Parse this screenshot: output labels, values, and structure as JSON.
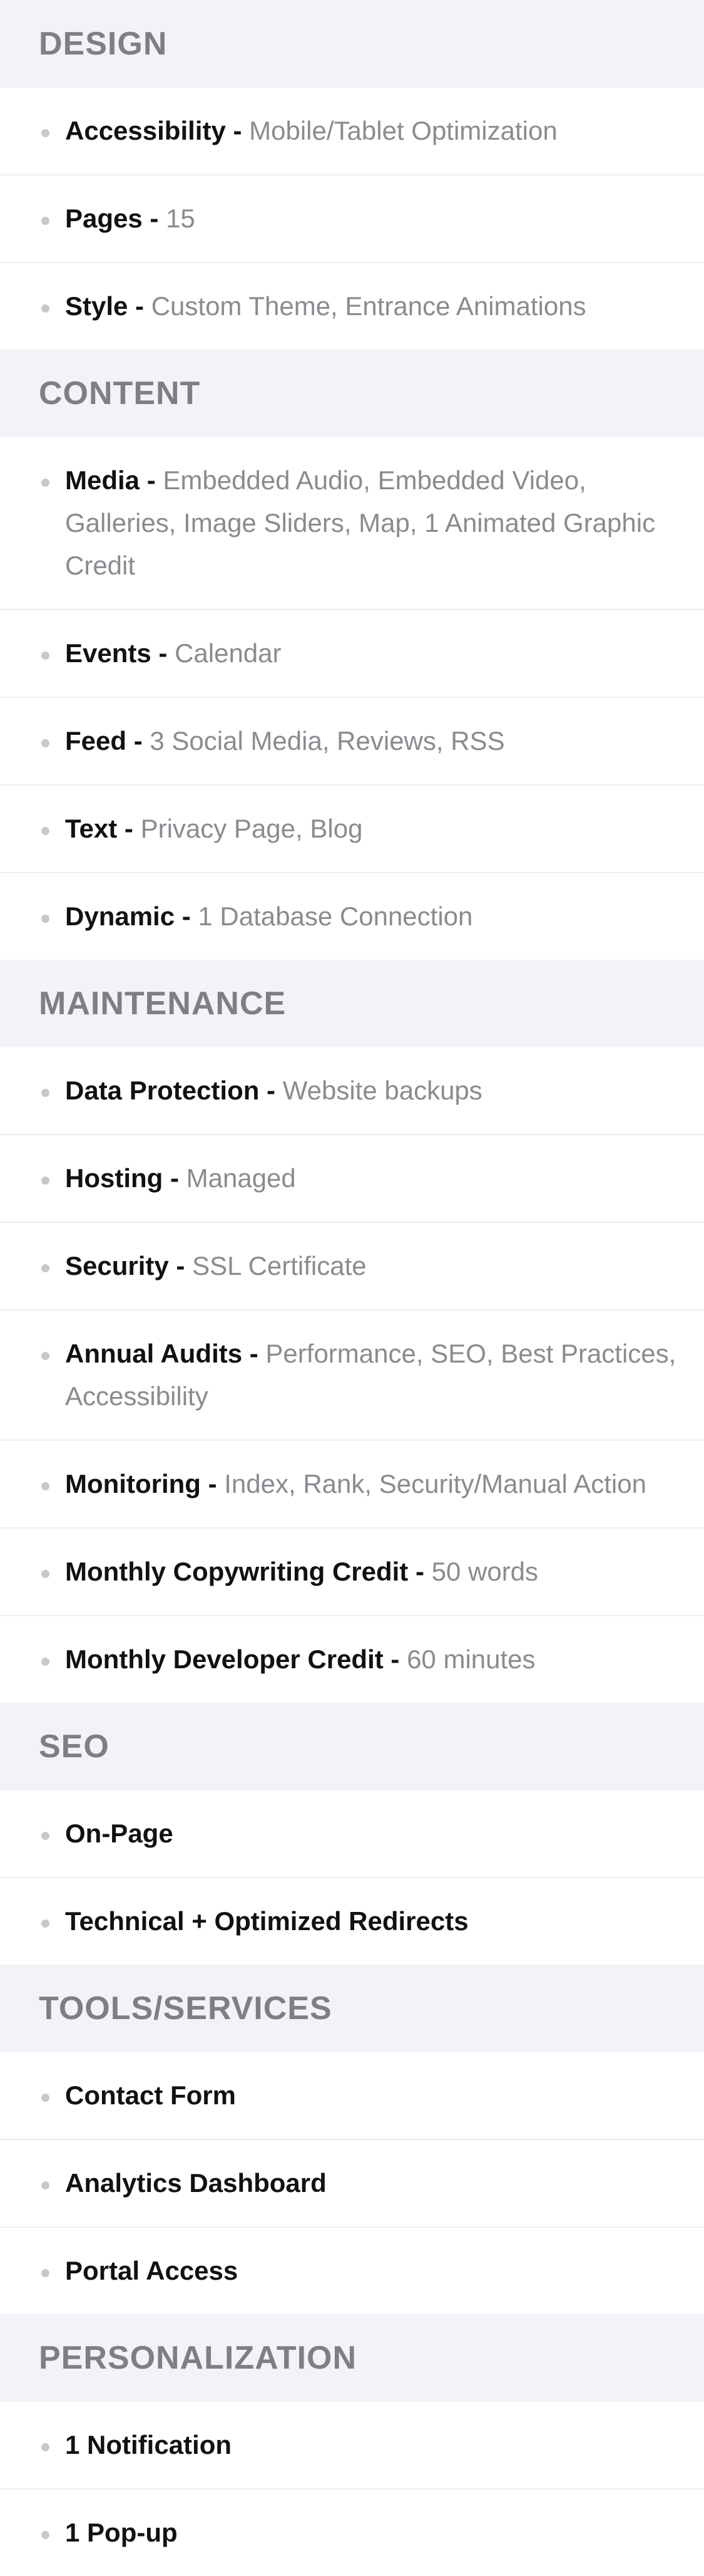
{
  "sections": [
    {
      "title": "DESIGN",
      "items": [
        {
          "label": "Accessibility",
          "sep": " - ",
          "value": "Mobile/Tablet Optimization"
        },
        {
          "label": "Pages",
          "sep": " - ",
          "value": "15"
        },
        {
          "label": "Style",
          "sep": " - ",
          "value": "Custom Theme, Entrance Animations"
        }
      ]
    },
    {
      "title": "CONTENT",
      "items": [
        {
          "label": "Media",
          "sep": " - ",
          "value": "Embedded Audio, Embedded Video, Galleries, Image Sliders, Map, 1 Animated Graphic Credit"
        },
        {
          "label": "Events",
          "sep": " - ",
          "value": "Calendar"
        },
        {
          "label": "Feed",
          "sep": " - ",
          "value": "3 Social Media, Reviews, RSS"
        },
        {
          "label": "Text",
          "sep": " - ",
          "value": "Privacy Page, Blog"
        },
        {
          "label": "Dynamic",
          "sep": " - ",
          "value": "1 Database Connection"
        }
      ]
    },
    {
      "title": "MAINTENANCE",
      "items": [
        {
          "label": "Data Protection",
          "sep": " - ",
          "value": "Website backups"
        },
        {
          "label": "Hosting",
          "sep": " - ",
          "value": "Managed"
        },
        {
          "label": "Security",
          "sep": " - ",
          "value": "SSL Certificate"
        },
        {
          "label": "Annual Audits",
          "sep": " - ",
          "value": "Performance, SEO, Best Practices, Accessibility"
        },
        {
          "label": "Monitoring",
          "sep": " - ",
          "value": "Index, Rank, Security/Manual Action"
        },
        {
          "label": "Monthly Copywriting Credit",
          "sep": " - ",
          "value": "50 words"
        },
        {
          "label": "Monthly Developer Credit",
          "sep": " - ",
          "value": "60 minutes"
        }
      ]
    },
    {
      "title": "SEO",
      "items": [
        {
          "label": "On-Page",
          "sep": "",
          "value": ""
        },
        {
          "label": "Technical + Optimized Redirects",
          "sep": "",
          "value": ""
        }
      ]
    },
    {
      "title": "TOOLS/SERVICES",
      "items": [
        {
          "label": "Contact Form",
          "sep": "",
          "value": ""
        },
        {
          "label": "Analytics Dashboard",
          "sep": "",
          "value": ""
        },
        {
          "label": "Portal Access",
          "sep": "",
          "value": ""
        }
      ]
    },
    {
      "title": "PERSONALIZATION",
      "items": [
        {
          "label": "1 Notification",
          "sep": "",
          "value": ""
        },
        {
          "label": "1 Pop-up",
          "sep": "",
          "value": ""
        }
      ]
    }
  ]
}
